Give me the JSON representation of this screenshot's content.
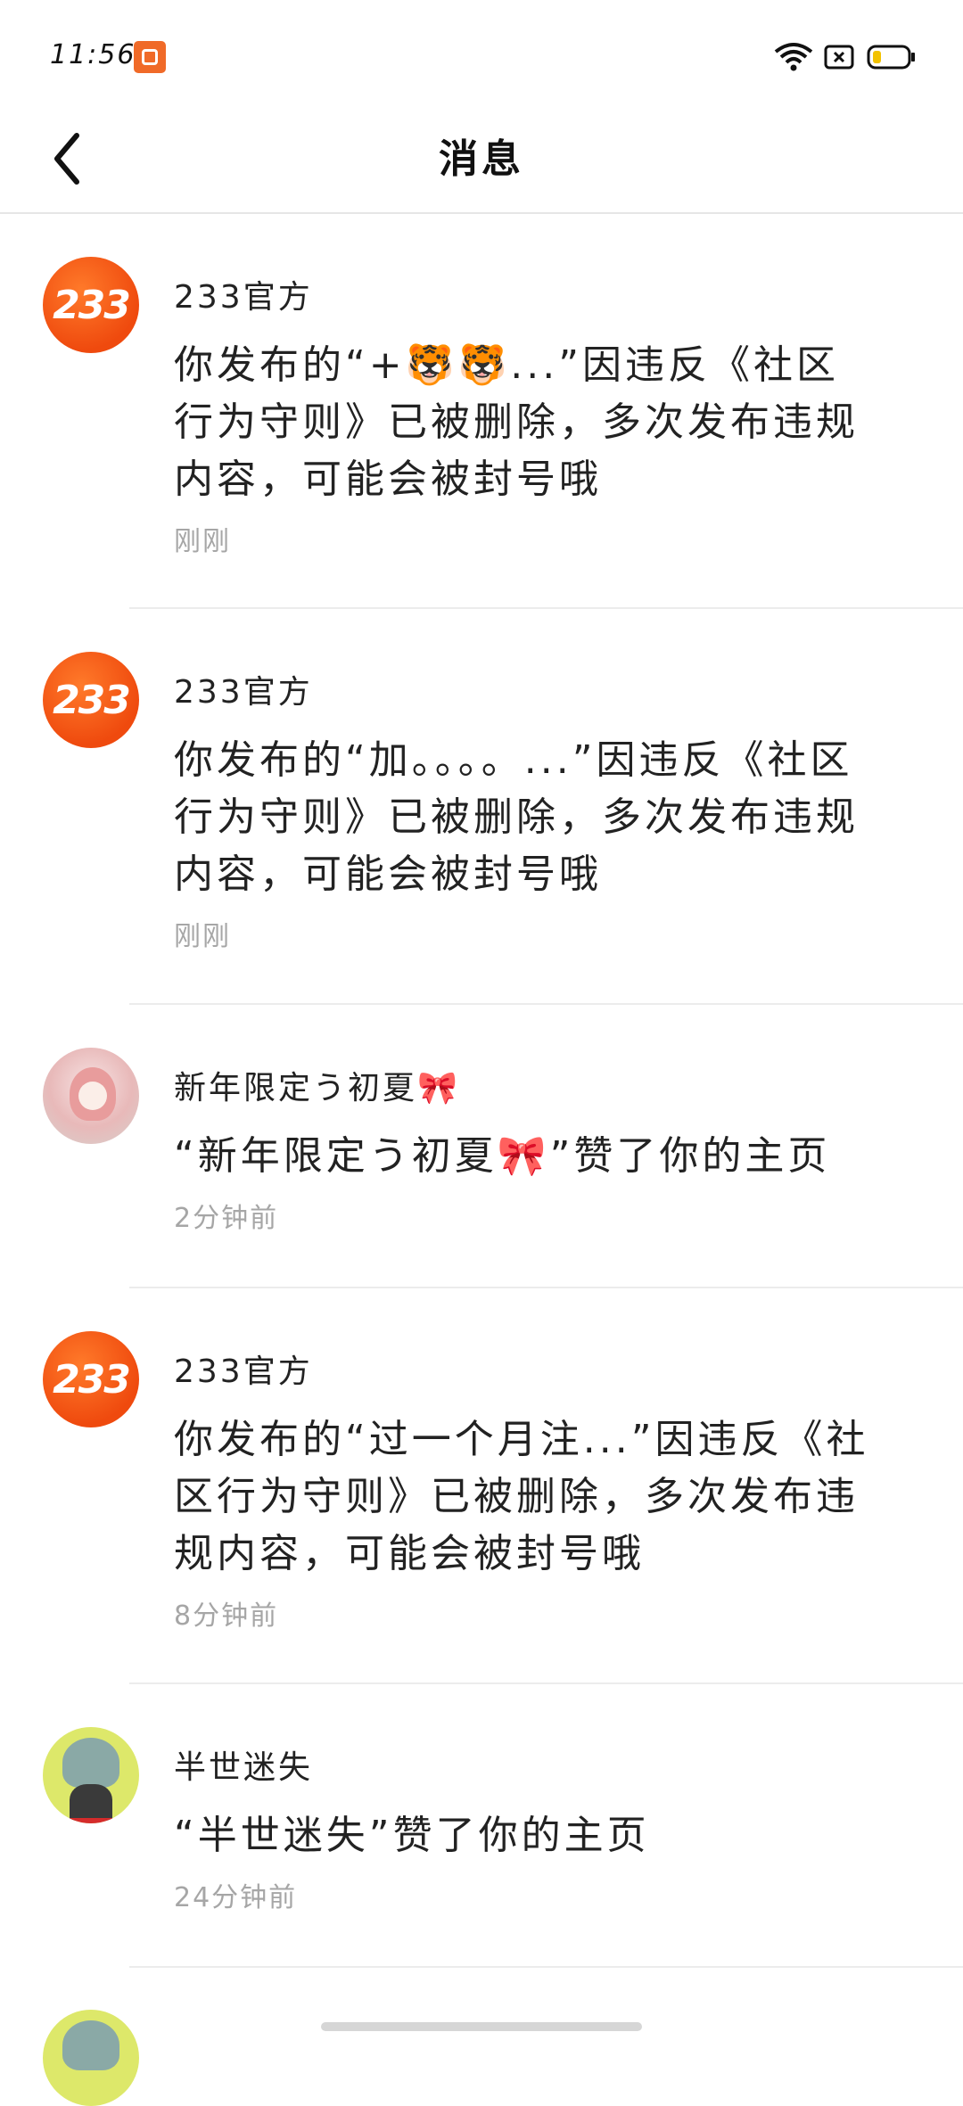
{
  "status_bar": {
    "time": "11:56"
  },
  "header": {
    "title": "消息"
  },
  "messages": [
    {
      "avatar": "233",
      "sender": "233官方",
      "text": "你发布的“+🐯🐯...”因违反《社区行为守则》已被删除，多次发布违规内容，可能会被封号哦",
      "time": "刚刚"
    },
    {
      "avatar": "233",
      "sender": "233官方",
      "text": "你发布的“加。。。。...”因违反《社区行为守则》已被删除，多次发布违规内容，可能会被封号哦",
      "time": "刚刚"
    },
    {
      "sender": "新年限定う初夏🎀",
      "text": "“新年限定う初夏🎀”赞了你的主页",
      "time": "2分钟前"
    },
    {
      "avatar": "233",
      "sender": "233官方",
      "text": "你发布的“过一个月注...”因违反《社区行为守则》已被删除，多次发布违规内容，可能会被封号哦",
      "time": "8分钟前"
    },
    {
      "sender": "半世迷失",
      "text": "“半世迷失”赞了你的主页",
      "time": "24分钟前"
    }
  ],
  "colors": {
    "brand_orange": "#ef4a0e",
    "time_gray": "#a6a6a6",
    "divider": "#ececec"
  },
  "icons": {
    "back": "chevron-left-icon",
    "wifi": "wifi-icon",
    "sim": "sim-off-icon",
    "battery": "battery-low-icon"
  }
}
